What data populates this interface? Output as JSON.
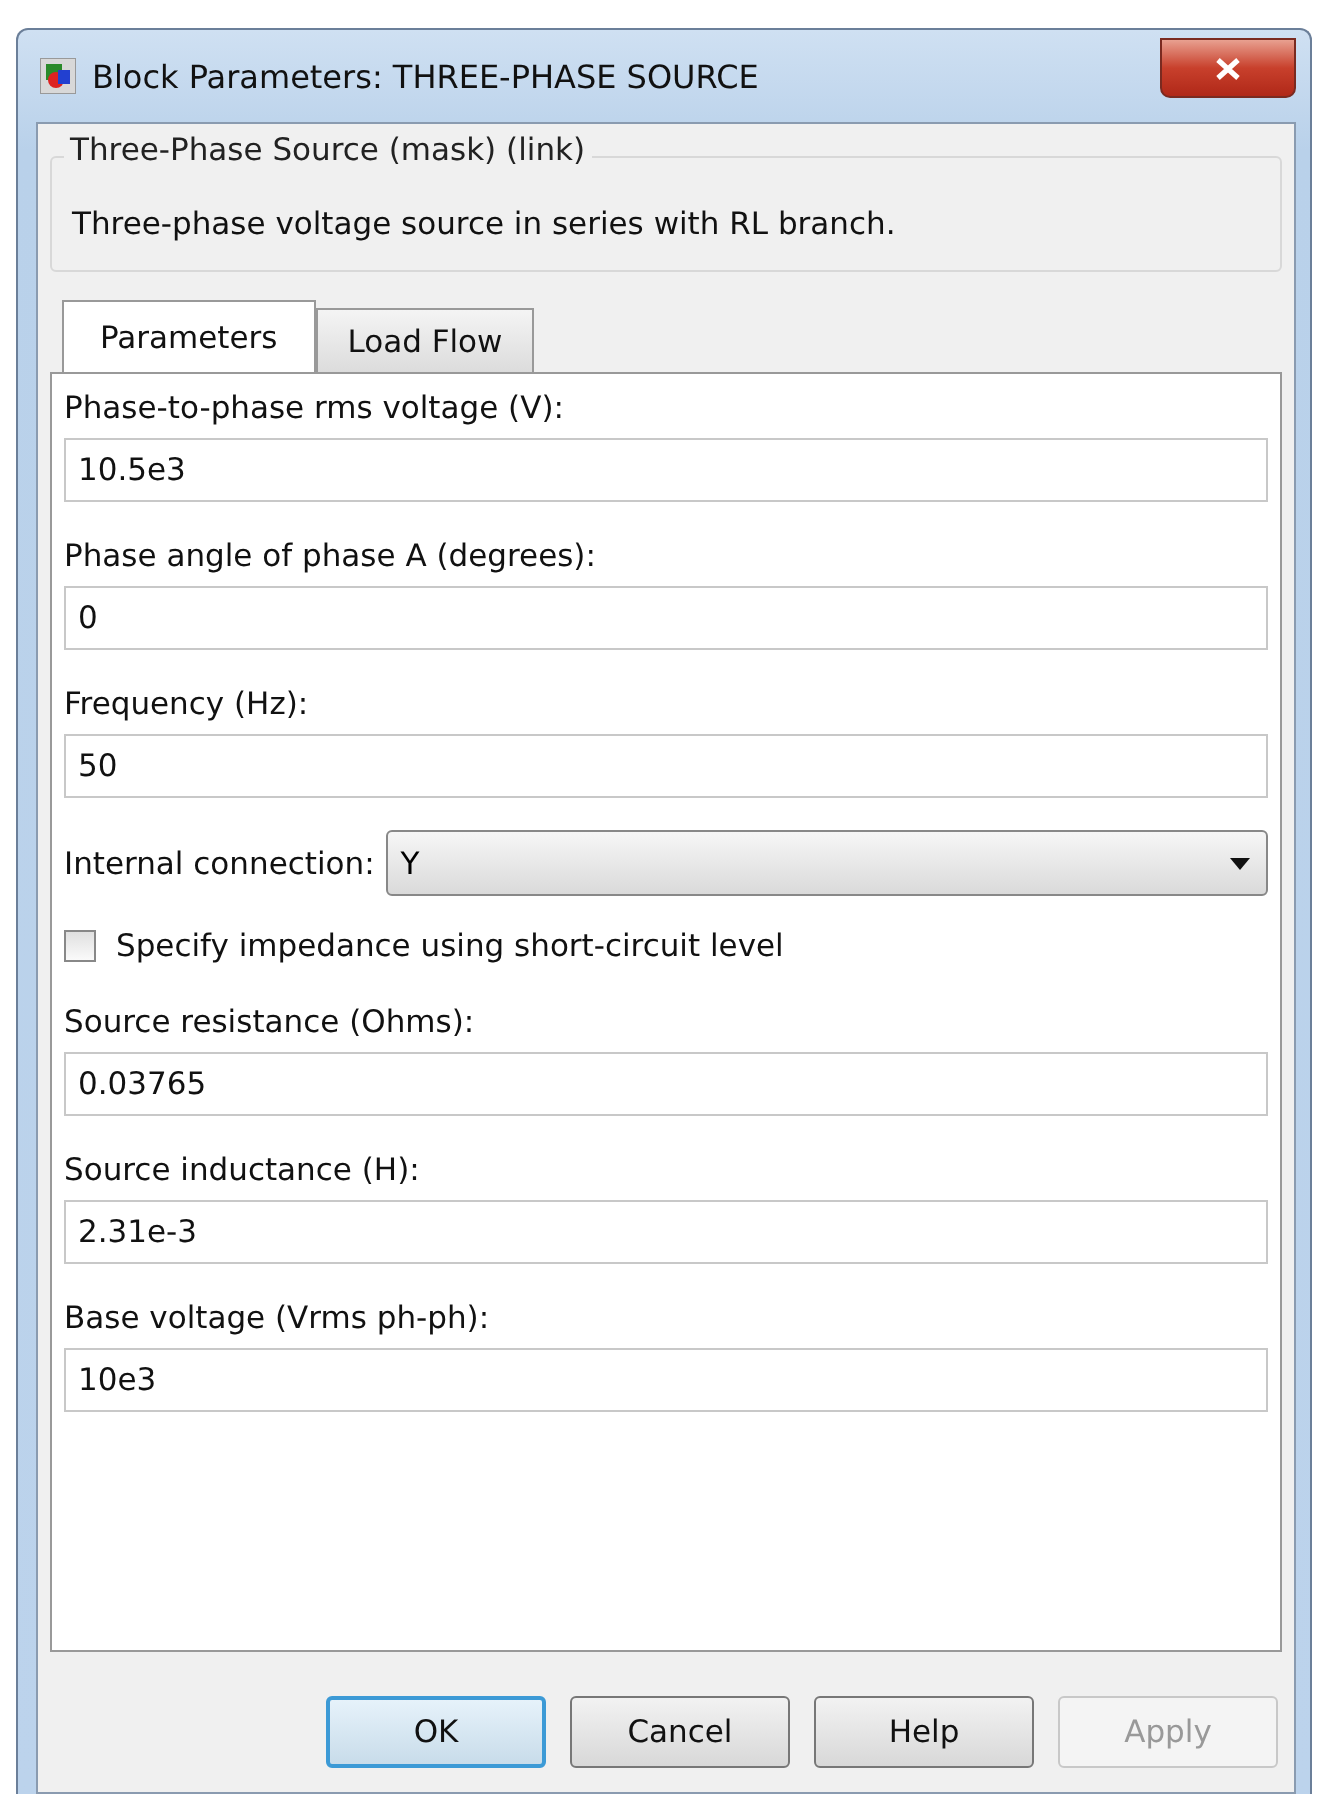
{
  "window": {
    "title": "Block Parameters: THREE-PHASE SOURCE"
  },
  "group": {
    "title": "Three-Phase Source (mask) (link)",
    "description": "Three-phase voltage source in series with RL branch."
  },
  "tabs": [
    {
      "label": "Parameters",
      "selected": true
    },
    {
      "label": "Load Flow",
      "selected": false
    }
  ],
  "fields": [
    {
      "kind": "text",
      "label": "Phase-to-phase rms voltage (V):",
      "value": "10.5e3"
    },
    {
      "kind": "text",
      "label": "Phase angle of phase A (degrees):",
      "value": "0"
    },
    {
      "kind": "text",
      "label": "Frequency (Hz):",
      "value": "50"
    },
    {
      "kind": "dropdown",
      "label": "Internal connection:",
      "value": "Y"
    },
    {
      "kind": "checkbox",
      "label": "Specify impedance using short-circuit level",
      "checked": false
    },
    {
      "kind": "text",
      "label": "Source resistance (Ohms):",
      "value": "0.03765"
    },
    {
      "kind": "text",
      "label": "Source inductance (H):",
      "value": "2.31e-3"
    },
    {
      "kind": "text",
      "label": "Base voltage (Vrms ph-ph):",
      "value": "10e3"
    }
  ],
  "buttons": [
    {
      "label": "OK",
      "disabled": false,
      "default": true
    },
    {
      "label": "Cancel",
      "disabled": false,
      "default": false
    },
    {
      "label": "Help",
      "disabled": false,
      "default": false
    },
    {
      "label": "Apply",
      "disabled": true,
      "default": false
    }
  ]
}
